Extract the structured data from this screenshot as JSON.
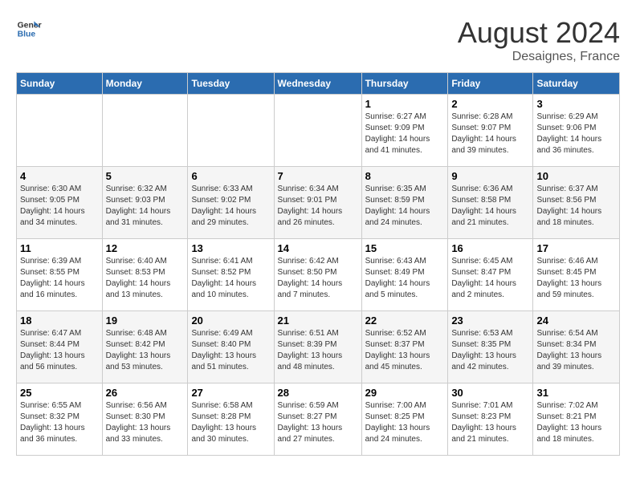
{
  "logo": {
    "line1": "General",
    "line2": "Blue"
  },
  "title": "August 2024",
  "subtitle": "Desaignes, France",
  "weekdays": [
    "Sunday",
    "Monday",
    "Tuesday",
    "Wednesday",
    "Thursday",
    "Friday",
    "Saturday"
  ],
  "weeks": [
    [
      {
        "day": "",
        "info": ""
      },
      {
        "day": "",
        "info": ""
      },
      {
        "day": "",
        "info": ""
      },
      {
        "day": "",
        "info": ""
      },
      {
        "day": "1",
        "info": "Sunrise: 6:27 AM\nSunset: 9:09 PM\nDaylight: 14 hours and 41 minutes."
      },
      {
        "day": "2",
        "info": "Sunrise: 6:28 AM\nSunset: 9:07 PM\nDaylight: 14 hours and 39 minutes."
      },
      {
        "day": "3",
        "info": "Sunrise: 6:29 AM\nSunset: 9:06 PM\nDaylight: 14 hours and 36 minutes."
      }
    ],
    [
      {
        "day": "4",
        "info": "Sunrise: 6:30 AM\nSunset: 9:05 PM\nDaylight: 14 hours and 34 minutes."
      },
      {
        "day": "5",
        "info": "Sunrise: 6:32 AM\nSunset: 9:03 PM\nDaylight: 14 hours and 31 minutes."
      },
      {
        "day": "6",
        "info": "Sunrise: 6:33 AM\nSunset: 9:02 PM\nDaylight: 14 hours and 29 minutes."
      },
      {
        "day": "7",
        "info": "Sunrise: 6:34 AM\nSunset: 9:01 PM\nDaylight: 14 hours and 26 minutes."
      },
      {
        "day": "8",
        "info": "Sunrise: 6:35 AM\nSunset: 8:59 PM\nDaylight: 14 hours and 24 minutes."
      },
      {
        "day": "9",
        "info": "Sunrise: 6:36 AM\nSunset: 8:58 PM\nDaylight: 14 hours and 21 minutes."
      },
      {
        "day": "10",
        "info": "Sunrise: 6:37 AM\nSunset: 8:56 PM\nDaylight: 14 hours and 18 minutes."
      }
    ],
    [
      {
        "day": "11",
        "info": "Sunrise: 6:39 AM\nSunset: 8:55 PM\nDaylight: 14 hours and 16 minutes."
      },
      {
        "day": "12",
        "info": "Sunrise: 6:40 AM\nSunset: 8:53 PM\nDaylight: 14 hours and 13 minutes."
      },
      {
        "day": "13",
        "info": "Sunrise: 6:41 AM\nSunset: 8:52 PM\nDaylight: 14 hours and 10 minutes."
      },
      {
        "day": "14",
        "info": "Sunrise: 6:42 AM\nSunset: 8:50 PM\nDaylight: 14 hours and 7 minutes."
      },
      {
        "day": "15",
        "info": "Sunrise: 6:43 AM\nSunset: 8:49 PM\nDaylight: 14 hours and 5 minutes."
      },
      {
        "day": "16",
        "info": "Sunrise: 6:45 AM\nSunset: 8:47 PM\nDaylight: 14 hours and 2 minutes."
      },
      {
        "day": "17",
        "info": "Sunrise: 6:46 AM\nSunset: 8:45 PM\nDaylight: 13 hours and 59 minutes."
      }
    ],
    [
      {
        "day": "18",
        "info": "Sunrise: 6:47 AM\nSunset: 8:44 PM\nDaylight: 13 hours and 56 minutes."
      },
      {
        "day": "19",
        "info": "Sunrise: 6:48 AM\nSunset: 8:42 PM\nDaylight: 13 hours and 53 minutes."
      },
      {
        "day": "20",
        "info": "Sunrise: 6:49 AM\nSunset: 8:40 PM\nDaylight: 13 hours and 51 minutes."
      },
      {
        "day": "21",
        "info": "Sunrise: 6:51 AM\nSunset: 8:39 PM\nDaylight: 13 hours and 48 minutes."
      },
      {
        "day": "22",
        "info": "Sunrise: 6:52 AM\nSunset: 8:37 PM\nDaylight: 13 hours and 45 minutes."
      },
      {
        "day": "23",
        "info": "Sunrise: 6:53 AM\nSunset: 8:35 PM\nDaylight: 13 hours and 42 minutes."
      },
      {
        "day": "24",
        "info": "Sunrise: 6:54 AM\nSunset: 8:34 PM\nDaylight: 13 hours and 39 minutes."
      }
    ],
    [
      {
        "day": "25",
        "info": "Sunrise: 6:55 AM\nSunset: 8:32 PM\nDaylight: 13 hours and 36 minutes."
      },
      {
        "day": "26",
        "info": "Sunrise: 6:56 AM\nSunset: 8:30 PM\nDaylight: 13 hours and 33 minutes."
      },
      {
        "day": "27",
        "info": "Sunrise: 6:58 AM\nSunset: 8:28 PM\nDaylight: 13 hours and 30 minutes."
      },
      {
        "day": "28",
        "info": "Sunrise: 6:59 AM\nSunset: 8:27 PM\nDaylight: 13 hours and 27 minutes."
      },
      {
        "day": "29",
        "info": "Sunrise: 7:00 AM\nSunset: 8:25 PM\nDaylight: 13 hours and 24 minutes."
      },
      {
        "day": "30",
        "info": "Sunrise: 7:01 AM\nSunset: 8:23 PM\nDaylight: 13 hours and 21 minutes."
      },
      {
        "day": "31",
        "info": "Sunrise: 7:02 AM\nSunset: 8:21 PM\nDaylight: 13 hours and 18 minutes."
      }
    ]
  ]
}
